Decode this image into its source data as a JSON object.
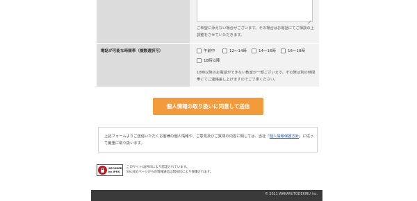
{
  "form": {
    "remarks_note": "ご希望に添えない場合がございます。その場合はお電話にてご相談の上調整をさせていただきます。",
    "time_label": "電話が可能な時間帯（複数選択可）",
    "time_options": [
      "午前中",
      "12～14時",
      "14～16時",
      "16～18時",
      "18時以降"
    ],
    "time_note": "18時以降のお電話ができない教室が一部ございます。その際は別の時間帯にてご連絡差し上げますのでご了承ください。"
  },
  "submit": {
    "label": "個人情報の取り扱いに同意して送信"
  },
  "privacy": {
    "text_before": "上記フォームよりご送信いただくお客様の個人情報や、ご意見及びご質問の内容に関しては、当社「",
    "link": "個人情報保護方針",
    "text_after": "」に従って厳重に取り扱います。"
  },
  "seal": {
    "line1": "SECURED",
    "line2": "by JPRS",
    "desc_line1": "このサイトはJPRSにより認証されています。",
    "desc_line2": "SSL対応ページからの情報送信は暗号化により保護されます。"
  },
  "footer": {
    "copyright": "© 2021 WAKARUTODEKIRU inc."
  }
}
